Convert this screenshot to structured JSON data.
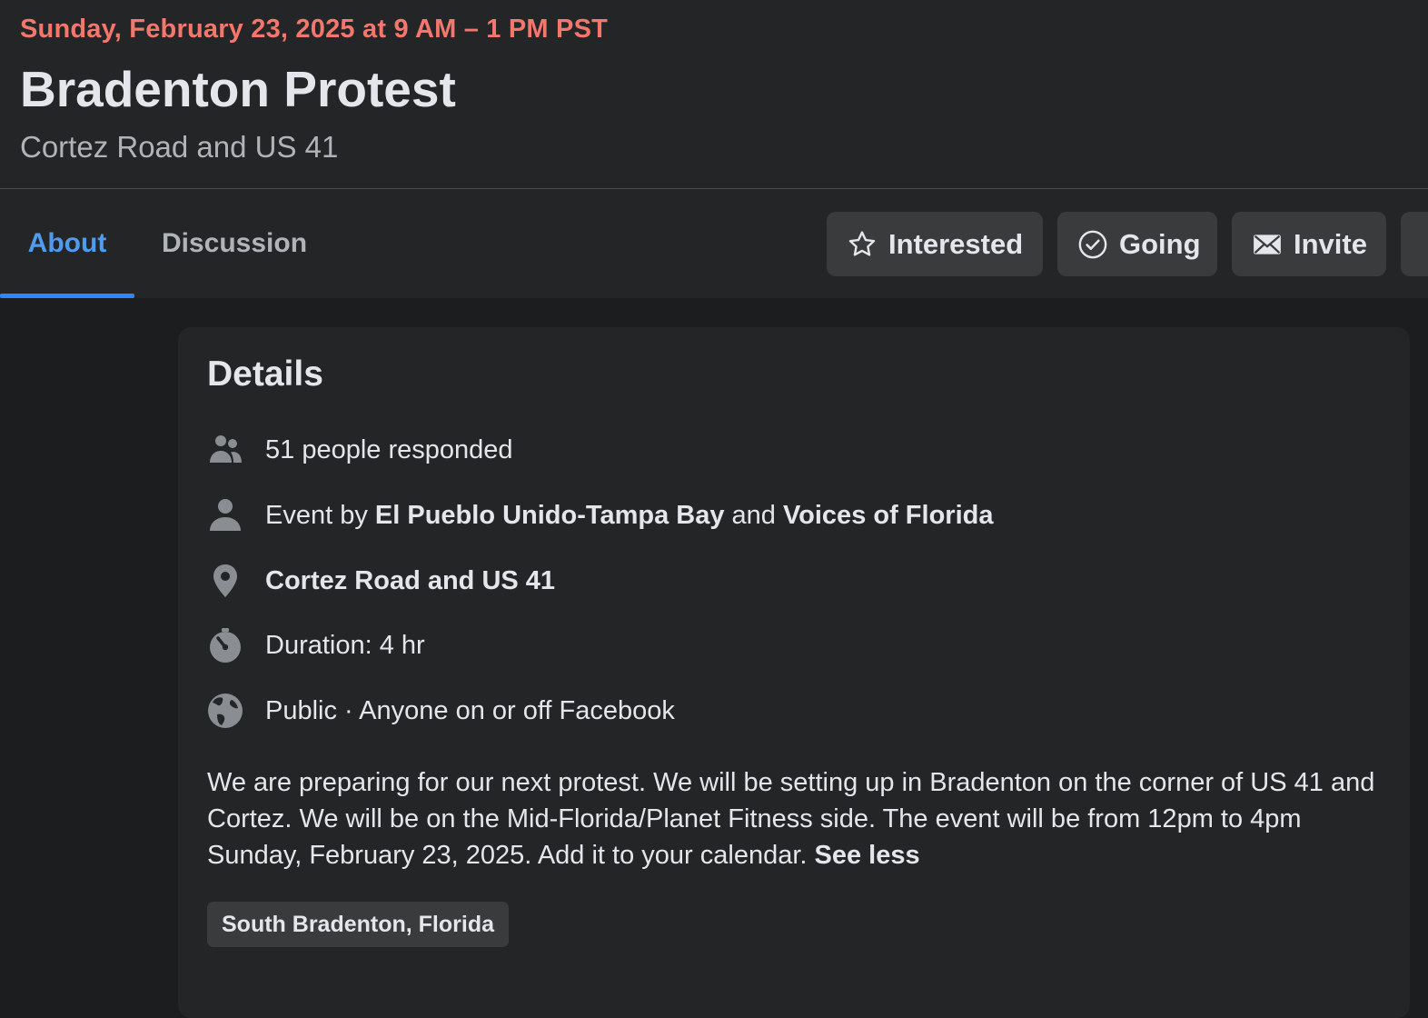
{
  "event": {
    "date": "Sunday, February 23, 2025 at 9 AM – 1 PM PST",
    "title": "Bradenton Protest",
    "location": "Cortez Road and US 41"
  },
  "tabs": [
    {
      "label": "About",
      "active": true
    },
    {
      "label": "Discussion",
      "active": false
    }
  ],
  "actions": {
    "interested": "Interested",
    "going": "Going",
    "invite": "Invite"
  },
  "details": {
    "title": "Details",
    "responded": "51 people responded",
    "host_prefix": "Event by ",
    "host_1": "El Pueblo Unido-Tampa Bay",
    "host_joiner": " and ",
    "host_2": "Voices of Florida",
    "place": "Cortez Road and US 41",
    "duration": "Duration: 4 hr",
    "privacy": "Public · Anyone on or off Facebook",
    "description": "We are preparing for our next protest. We will be setting up in Bradenton on the corner of US 41 and Cortez. We will be on the Mid-Florida/Planet Fitness side. The event will be from 12pm to 4pm Sunday, February 23, 2025. Add it to your calendar. ",
    "see_less": "See less",
    "tag": "South Bradenton, Florida"
  },
  "colors": {
    "date": "#f3776c",
    "active_tab": "#4e9bf0",
    "tab_indicator": "#2d88ff",
    "surface": "#242526",
    "background": "#1c1d1e",
    "button": "#3a3b3c",
    "icon": "#8a8d91"
  },
  "icons": {
    "interested": "star-icon",
    "going": "check-circle-icon",
    "invite": "envelope-icon",
    "responded": "people-icon",
    "host": "person-icon",
    "place": "map-pin-icon",
    "duration": "stopwatch-icon",
    "privacy": "globe-icon"
  }
}
